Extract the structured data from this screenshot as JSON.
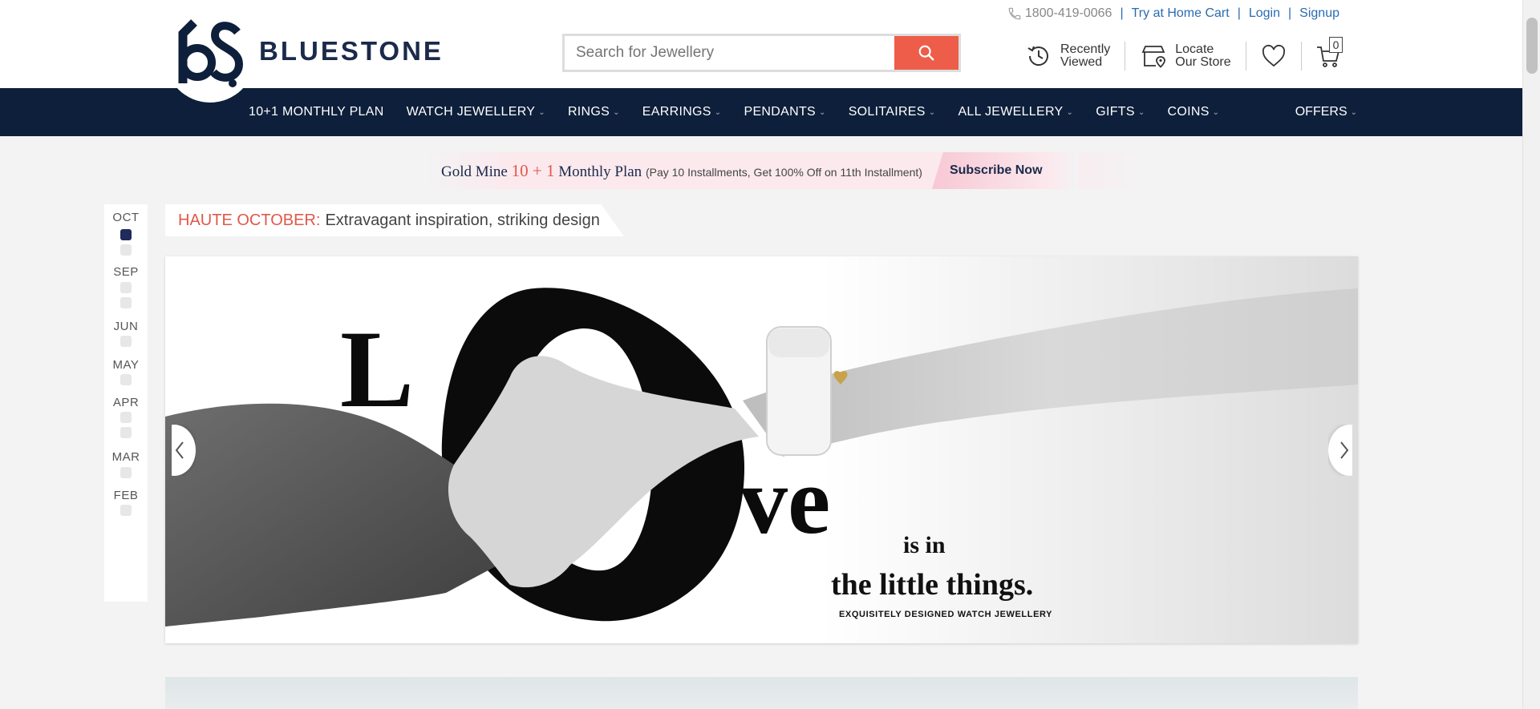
{
  "brand": {
    "name": "BLUESTONE"
  },
  "toplinks": {
    "phone": "1800-419-0066",
    "try_home": "Try at Home Cart",
    "login": "Login",
    "signup": "Signup",
    "sep": "|"
  },
  "search": {
    "placeholder": "Search for Jewellery"
  },
  "header_icons": {
    "recently_line1": "Recently",
    "recently_line2": "Viewed",
    "locate_line1": "Locate",
    "locate_line2": "Our Store",
    "cart_count": "0"
  },
  "nav": {
    "items": [
      {
        "label": "10+1 MONTHLY PLAN",
        "chevron": ""
      },
      {
        "label": "WATCH JEWELLERY",
        "chevron": "⌄"
      },
      {
        "label": "RINGS",
        "chevron": "⌄"
      },
      {
        "label": "EARRINGS",
        "chevron": "⌄"
      },
      {
        "label": "PENDANTS",
        "chevron": "⌄"
      },
      {
        "label": "SOLITAIRES",
        "chevron": "⌄"
      },
      {
        "label": "ALL JEWELLERY",
        "chevron": "⌄"
      },
      {
        "label": "GIFTS",
        "chevron": "⌄"
      },
      {
        "label": "COINS",
        "chevron": "⌄"
      }
    ],
    "offers": "OFFERS",
    "offers_chevron": "⌄"
  },
  "promo": {
    "text_a": "Gold Mine ",
    "highlight": "10 + 1",
    "text_b": " Monthly Plan ",
    "small": "(Pay 10 Installments, Get 100% Off on 11th Installment)",
    "cta": "Subscribe Now"
  },
  "timeline": {
    "months": [
      "OCT",
      "SEP",
      "JUN",
      "MAY",
      "APR",
      "MAR",
      "FEB"
    ]
  },
  "headline": {
    "red": "HAUTE OCTOBER:",
    "rest": "Extravagant inspiration, striking design"
  },
  "banner": {
    "letter_l": "L",
    "letters_ve": "ve",
    "is_in": "is in",
    "little_things": "the little things.",
    "tagline": "EXQUISITELY DESIGNED WATCH JEWELLERY"
  },
  "colors": {
    "nav_bg": "#0d1f3a",
    "accent_red": "#ee5d49",
    "link_blue": "#2b6cb0",
    "brand_navy": "#1b2a4a"
  }
}
